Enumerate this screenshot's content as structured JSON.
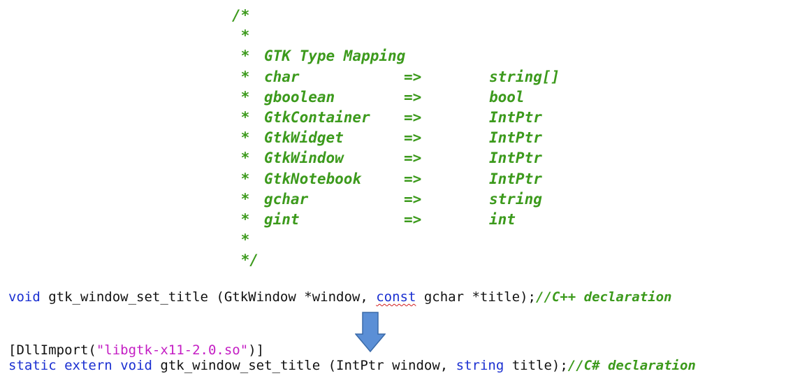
{
  "comment_block": {
    "lines": [
      {
        "star": "/*",
        "name": "",
        "arrow": "",
        "type": ""
      },
      {
        "star": " *",
        "name": "",
        "arrow": "",
        "type": ""
      },
      {
        "star": " *",
        "name": "GTK Type Mapping",
        "arrow": "",
        "type": ""
      },
      {
        "star": " *",
        "name": "char",
        "arrow": "=>",
        "type": "string[]"
      },
      {
        "star": " *",
        "name": "gboolean",
        "arrow": "=>",
        "type": "bool"
      },
      {
        "star": " *",
        "name": "GtkContainer",
        "arrow": "=>",
        "type": "IntPtr"
      },
      {
        "star": " *",
        "name": "GtkWidget",
        "arrow": "=>",
        "type": "IntPtr"
      },
      {
        "star": " *",
        "name": "GtkWindow",
        "arrow": "=>",
        "type": "IntPtr"
      },
      {
        "star": " *",
        "name": "GtkNotebook",
        "arrow": "=>",
        "type": "IntPtr"
      },
      {
        "star": " *",
        "name": "gchar",
        "arrow": "=>",
        "type": "string"
      },
      {
        "star": " *",
        "name": "gint",
        "arrow": "=>",
        "type": "int"
      },
      {
        "star": " *",
        "name": "",
        "arrow": "",
        "type": ""
      },
      {
        "star": " */",
        "name": "",
        "arrow": "",
        "type": ""
      }
    ]
  },
  "cpp_line": {
    "kw_void": "void",
    "signature_start": " gtk_window_set_title (GtkWindow *window, ",
    "kw_const": "const",
    "signature_end": " gchar *title);",
    "comment": "//C++ declaration"
  },
  "dll_line": {
    "prefix": "[DllImport(",
    "string": "\"libgtk-x11-2.0.so\"",
    "suffix": ")]"
  },
  "cs_line": {
    "kw_static": "static",
    "kw_extern": "extern",
    "kw_void": "void",
    "sig_mid": " gtk_window_set_title (IntPtr window, ",
    "kw_string": "string",
    "sig_end": " title);",
    "comment": "//C# declaration"
  },
  "icons": {
    "conversion_arrow": "down-arrow-icon",
    "arrow_fill": "#5b8fd6",
    "arrow_stroke": "#3a6aa8"
  },
  "colors": {
    "comment": "#3c9a1c",
    "keyword": "#1a2fd1",
    "string": "#c41ec4",
    "text": "#111111"
  }
}
